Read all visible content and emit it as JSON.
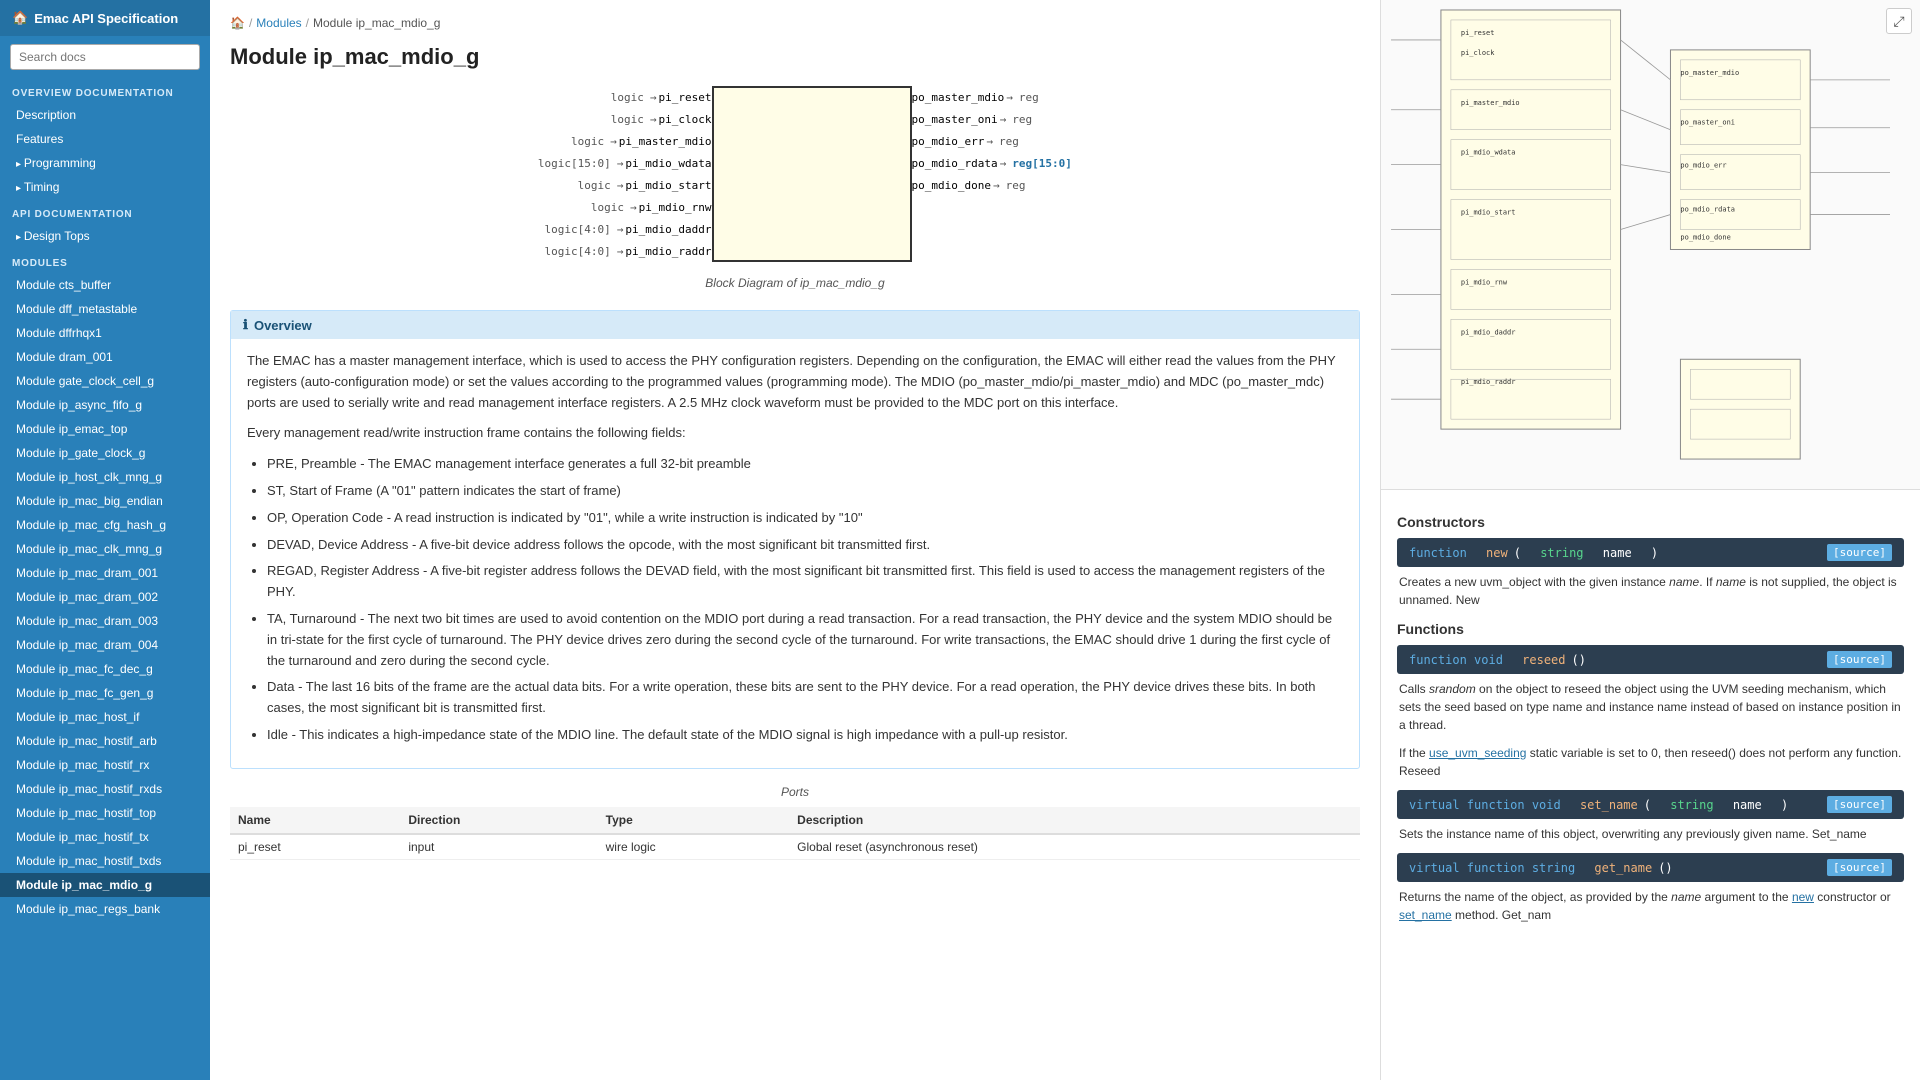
{
  "sidebar": {
    "title": "Emac API Specification",
    "search_placeholder": "Search docs",
    "sections": [
      {
        "header": "Overview Documentation",
        "items": [
          {
            "label": "Description",
            "id": "description",
            "level": 1,
            "active": false
          },
          {
            "label": "Features",
            "id": "features",
            "level": 1,
            "active": false
          },
          {
            "label": "Programming",
            "id": "programming",
            "level": 1,
            "active": false,
            "collapsible": true
          },
          {
            "label": "Timing",
            "id": "timing",
            "level": 1,
            "active": false,
            "collapsible": true
          }
        ]
      },
      {
        "header": "API Documentation",
        "items": [
          {
            "label": "Design Tops",
            "id": "design-tops",
            "level": 1,
            "active": false,
            "collapsible": true
          }
        ]
      },
      {
        "header": "Modules",
        "items": [
          {
            "label": "Module cts_buffer",
            "id": "cts_buffer",
            "level": 1,
            "active": false
          },
          {
            "label": "Module dff_metastable",
            "id": "dff_metastable",
            "level": 1,
            "active": false
          },
          {
            "label": "Module dffrhqx1",
            "id": "dffrhqx1",
            "level": 1,
            "active": false
          },
          {
            "label": "Module dram_001",
            "id": "dram_001",
            "level": 1,
            "active": false
          },
          {
            "label": "Module gate_clock_cell_g",
            "id": "gate_clock_cell_g",
            "level": 1,
            "active": false
          },
          {
            "label": "Module ip_async_fifo_g",
            "id": "ip_async_fifo_g",
            "level": 1,
            "active": false
          },
          {
            "label": "Module ip_emac_top",
            "id": "ip_emac_top",
            "level": 1,
            "active": false
          },
          {
            "label": "Module ip_gate_clock_g",
            "id": "ip_gate_clock_g",
            "level": 1,
            "active": false
          },
          {
            "label": "Module ip_host_clk_mng_g",
            "id": "ip_host_clk_mng_g",
            "level": 1,
            "active": false
          },
          {
            "label": "Module ip_mac_big_endian",
            "id": "ip_mac_big_endian",
            "level": 1,
            "active": false
          },
          {
            "label": "Module ip_mac_cfg_hash_g",
            "id": "ip_mac_cfg_hash_g",
            "level": 1,
            "active": false
          },
          {
            "label": "Module ip_mac_clk_mng_g",
            "id": "ip_mac_clk_mng_g",
            "level": 1,
            "active": false
          },
          {
            "label": "Module ip_mac_dram_001",
            "id": "ip_mac_dram_001",
            "level": 1,
            "active": false
          },
          {
            "label": "Module ip_mac_dram_002",
            "id": "ip_mac_dram_002",
            "level": 1,
            "active": false
          },
          {
            "label": "Module ip_mac_dram_003",
            "id": "ip_mac_dram_003",
            "level": 1,
            "active": false
          },
          {
            "label": "Module ip_mac_dram_004",
            "id": "ip_mac_dram_004",
            "level": 1,
            "active": false
          },
          {
            "label": "Module ip_mac_fc_dec_g",
            "id": "ip_mac_fc_dec_g",
            "level": 1,
            "active": false
          },
          {
            "label": "Module ip_mac_fc_gen_g",
            "id": "ip_mac_fc_gen_g",
            "level": 1,
            "active": false
          },
          {
            "label": "Module ip_mac_host_if",
            "id": "ip_mac_host_if",
            "level": 1,
            "active": false
          },
          {
            "label": "Module ip_mac_hostif_arb",
            "id": "ip_mac_hostif_arb",
            "level": 1,
            "active": false
          },
          {
            "label": "Module ip_mac_hostif_rx",
            "id": "ip_mac_hostif_rx",
            "level": 1,
            "active": false
          },
          {
            "label": "Module ip_mac_hostif_rxds",
            "id": "ip_mac_hostif_rxds",
            "level": 1,
            "active": false
          },
          {
            "label": "Module ip_mac_hostif_top",
            "id": "ip_mac_hostif_top",
            "level": 1,
            "active": false
          },
          {
            "label": "Module ip_mac_hostif_tx",
            "id": "ip_mac_hostif_tx",
            "level": 1,
            "active": false
          },
          {
            "label": "Module ip_mac_hostif_txds",
            "id": "ip_mac_hostif_txds",
            "level": 1,
            "active": false
          },
          {
            "label": "Module ip_mac_mdio_g",
            "id": "ip_mac_mdio_g",
            "level": 1,
            "active": true
          },
          {
            "label": "Module ip_mac_regs_bank",
            "id": "ip_mac_regs_bank",
            "level": 1,
            "active": false
          }
        ]
      }
    ]
  },
  "breadcrumb": {
    "home_icon": "🏠",
    "links": [
      "Modules"
    ],
    "current": "Module ip_mac_mdio_g"
  },
  "page": {
    "title": "Module ip_mac_mdio_g",
    "diagram_caption": "Block Diagram of ip_mac_mdio_g"
  },
  "diagram": {
    "left_ports": [
      {
        "type": "logic",
        "name": "pi_reset"
      },
      {
        "type": "logic",
        "name": "pi_clock"
      },
      {
        "type": "logic",
        "name": "pi_master_mdio"
      },
      {
        "type": "logic[15:0]",
        "name": "pi_mdio_wdata"
      },
      {
        "type": "logic",
        "name": "pi_mdio_start"
      },
      {
        "type": "logic",
        "name": "pi_mdio_rnw"
      },
      {
        "type": "logic[4:0]",
        "name": "pi_mdio_daddr"
      },
      {
        "type": "logic[4:0]",
        "name": "pi_mdio_raddr"
      }
    ],
    "right_ports": [
      {
        "name": "po_master_mdio",
        "reg": "reg"
      },
      {
        "name": "po_master_oni",
        "reg": "reg"
      },
      {
        "name": "po_mdio_err",
        "reg": "reg"
      },
      {
        "name": "po_mdio_rdata",
        "reg": "reg[15:0]"
      },
      {
        "name": "po_mdio_done",
        "reg": "reg"
      },
      {
        "name": "",
        "reg": ""
      },
      {
        "name": "",
        "reg": ""
      },
      {
        "name": "",
        "reg": ""
      }
    ]
  },
  "overview": {
    "title": "Overview",
    "info_icon": "ℹ",
    "body": "The EMAC has a master management interface, which is used to access the PHY configuration registers. Depending on the configuration, the EMAC will either read the values from the PHY registers (auto-configuration mode) or set the values according to the programmed values (programming mode). The MDIO (po_master_mdio/pi_master_mdio) and MDC (po_master_mdc) ports are used to serially write and read management interface registers. A 2.5 MHz clock waveform must be provided to the MDC port on this interface.",
    "fields_intro": "Every management read/write instruction frame contains the following fields:",
    "fields": [
      "PRE, Preamble - The EMAC management interface generates a full 32-bit preamble",
      "ST, Start of Frame (A \"01\" pattern indicates the start of frame)",
      "OP, Operation Code - A read instruction is indicated by \"01\", while a write instruction is indicated by \"10\"",
      "DEVAD, Device Address - A five-bit device address follows the opcode, with the most significant bit transmitted first.",
      "REGAD, Register Address - A five-bit register address follows the DEVAD field, with the most significant bit transmitted first. This field is used to access the management registers of the PHY.",
      "TA, Turnaround - The next two bit times are used to avoid contention on the MDIO port during a read transaction. For a read transaction, the PHY device and the system MDIO should be in tri-state for the first cycle of turnaround. The PHY device drives zero during the second cycle of the turnaround. For write transactions, the EMAC should drive 1 during the first cycle of the turnaround and zero during the second cycle.",
      "Data - The last 16 bits of the frame are the actual data bits. For a write operation, these bits are sent to the PHY device. For a read operation, the PHY device drives these bits. In both cases, the most significant bit is transmitted first.",
      "Idle - This indicates a high-impedance state of the MDIO line. The default state of the MDIO signal is high impedance with a pull-up resistor."
    ]
  },
  "ports_table": {
    "caption": "Ports",
    "columns": [
      "Name",
      "Direction",
      "Type",
      "Description"
    ],
    "rows": [
      {
        "name": "pi_reset",
        "direction": "input",
        "type": "wire logic",
        "description": "Global reset (asynchronous reset)"
      }
    ]
  },
  "api": {
    "constructors_title": "Constructors",
    "functions_title": "Functions",
    "constructors": [
      {
        "sig_kw": "function",
        "sig_ret": "",
        "sig_name": "new",
        "sig_params": "string name",
        "source_label": "[source]",
        "desc": "Creates a new uvm_object with the given instance name. If name is not supplied, the object is unnamed. New"
      }
    ],
    "functions": [
      {
        "sig_kw": "function void",
        "sig_name": "reseed",
        "sig_params": "",
        "source_label": "[source]",
        "desc_parts": [
          {
            "text": "Calls ",
            "italic": false
          },
          {
            "text": "srandom",
            "italic": true
          },
          {
            "text": " on the object to reseed the object using the UVM seeding mechanism, which sets the seed based on type name and instance name instead of based on instance position in a thread.",
            "italic": false
          }
        ],
        "desc2": "If the use_uvm_seeding static variable is set to 0, then reseed() does not perform any function. Reseed"
      },
      {
        "sig_kw": "virtual function void",
        "sig_name": "set_name",
        "sig_params": "string name",
        "source_label": "[source]",
        "desc": "Sets the instance name of this object, overwriting any previously given name. Set_name"
      },
      {
        "sig_kw": "virtual function string",
        "sig_name": "get_name",
        "sig_params": "",
        "source_label": "[source]",
        "desc": "Returns the name of the object, as provided by the name argument to the new constructor or set_name method. Get_nam"
      }
    ]
  },
  "colors": {
    "sidebar_bg": "#2980b9",
    "sidebar_header_bg": "#2471a3",
    "active_item_bg": "#1a5276",
    "overview_header_bg": "#d6eaf8",
    "overview_border": "#bce0fd",
    "api_sig_bg": "#2c3e50",
    "api_kw_color": "#5dade2",
    "api_type_color": "#58d68d",
    "api_name_color": "#f0b27a",
    "source_btn_bg": "#5dade2"
  }
}
